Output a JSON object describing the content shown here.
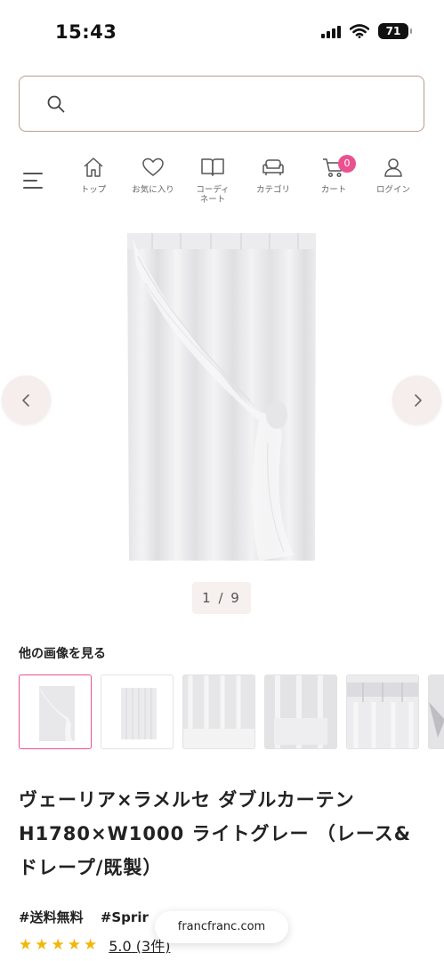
{
  "status_bar": {
    "time": "15:43",
    "battery": "71"
  },
  "search": {
    "placeholder": ""
  },
  "nav": {
    "items": [
      {
        "label": "トップ",
        "icon": "home-icon"
      },
      {
        "label": "お気に入り",
        "icon": "heart-icon"
      },
      {
        "label_line1": "コーディ",
        "label_line2": "ネート",
        "icon": "book-icon"
      },
      {
        "label": "カテゴリ",
        "icon": "sofa-icon"
      },
      {
        "label": "カート",
        "icon": "cart-icon",
        "badge": "0"
      },
      {
        "label": "ログイン",
        "icon": "user-icon"
      }
    ]
  },
  "carousel": {
    "pager": "1 / 9"
  },
  "gallery": {
    "heading": "他の画像を見る"
  },
  "product": {
    "title": "ヴェーリア×ラメルセ ダブルカーテン H1780×W1000 ライトグレー （レース&ドレープ/既製）",
    "tags": [
      "#送料無料",
      "#Sprir"
    ],
    "rating": {
      "stars": 5,
      "score": "5.0",
      "count": "(3件)"
    }
  },
  "browser": {
    "domain": "francfranc.com"
  },
  "colors": {
    "accent": "#e9528e",
    "search_border": "#b79b90",
    "star": "#f2b705"
  }
}
